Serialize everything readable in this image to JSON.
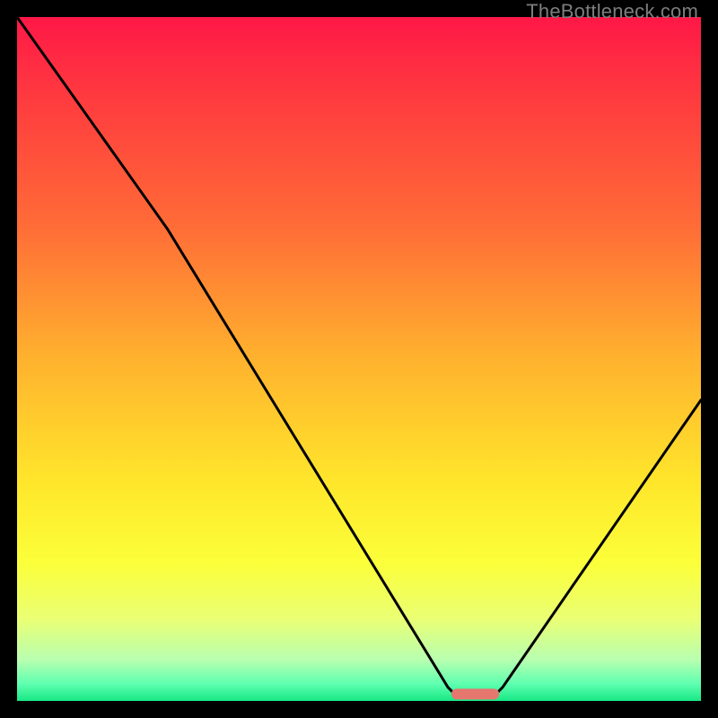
{
  "watermark": "TheBottleneck.com",
  "chart_data": {
    "type": "line",
    "title": "",
    "xlabel": "",
    "ylabel": "",
    "xlim": [
      0,
      100
    ],
    "ylim": [
      0,
      100
    ],
    "grid": false,
    "curve": [
      {
        "x": 0,
        "y": 100
      },
      {
        "x": 22,
        "y": 69
      },
      {
        "x": 63,
        "y": 2
      },
      {
        "x": 64,
        "y": 1
      },
      {
        "x": 70,
        "y": 1
      },
      {
        "x": 71,
        "y": 2
      },
      {
        "x": 100,
        "y": 44
      }
    ],
    "marker": {
      "x_start": 63.5,
      "x_end": 70.5,
      "y": 1.0,
      "color": "#e5776f"
    },
    "background_gradient": {
      "stops": [
        {
          "offset": 0.0,
          "color": "#ff1847"
        },
        {
          "offset": 0.12,
          "color": "#ff3b3f"
        },
        {
          "offset": 0.3,
          "color": "#ff6a37"
        },
        {
          "offset": 0.5,
          "color": "#ffb22e"
        },
        {
          "offset": 0.68,
          "color": "#ffe62b"
        },
        {
          "offset": 0.8,
          "color": "#fbff3a"
        },
        {
          "offset": 0.88,
          "color": "#eaff74"
        },
        {
          "offset": 0.94,
          "color": "#b8ffb0"
        },
        {
          "offset": 0.975,
          "color": "#5fffb0"
        },
        {
          "offset": 1.0,
          "color": "#17e884"
        }
      ]
    }
  }
}
